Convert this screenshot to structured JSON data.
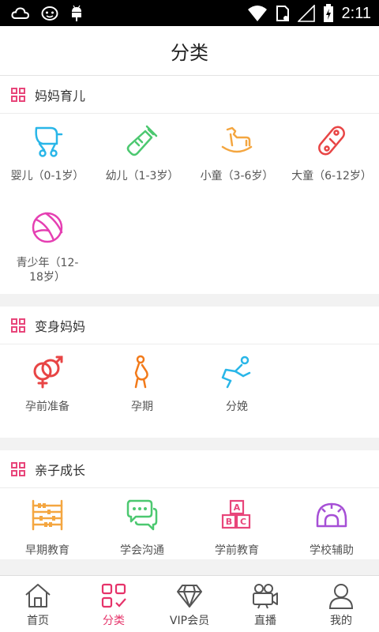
{
  "status_bar": {
    "time": "2:11"
  },
  "header": {
    "title": "分类"
  },
  "sections": [
    {
      "title": "妈妈育儿",
      "items": [
        {
          "label": "婴儿（0-1岁）",
          "icon": "stroller-icon",
          "color": "#29b6e8"
        },
        {
          "label": "幼儿（1-3岁）",
          "icon": "baby-bottle-icon",
          "color": "#4cc870"
        },
        {
          "label": "小童（3-6岁）",
          "icon": "rocking-horse-icon",
          "color": "#f4a640"
        },
        {
          "label": "大童（6-12岁）",
          "icon": "skateboard-icon",
          "color": "#e84545"
        },
        {
          "label": "青少年（12-18岁）",
          "icon": "ball-icon",
          "color": "#e53fb2"
        }
      ]
    },
    {
      "title": "变身妈妈",
      "items": [
        {
          "label": "孕前准备",
          "icon": "gender-icon",
          "color": "#e84545"
        },
        {
          "label": "孕期",
          "icon": "pregnant-icon",
          "color": "#f27a1a"
        },
        {
          "label": "分娩",
          "icon": "delivery-icon",
          "color": "#29b6e8"
        }
      ]
    },
    {
      "title": "亲子成长",
      "items": [
        {
          "label": "早期教育",
          "icon": "abacus-icon",
          "color": "#f4a640"
        },
        {
          "label": "学会沟通",
          "icon": "chat-icon",
          "color": "#4cc870"
        },
        {
          "label": "学前教育",
          "icon": "abc-blocks-icon",
          "color": "#e8457a"
        },
        {
          "label": "学校辅助",
          "icon": "protractor-icon",
          "color": "#a64fd6"
        }
      ]
    }
  ],
  "bottom_nav": [
    {
      "label": "首页",
      "icon": "home-icon",
      "active": false
    },
    {
      "label": "分类",
      "icon": "category-icon",
      "active": true
    },
    {
      "label": "VIP会员",
      "icon": "diamond-icon",
      "active": false
    },
    {
      "label": "直播",
      "icon": "video-camera-icon",
      "active": false
    },
    {
      "label": "我的",
      "icon": "profile-icon",
      "active": false
    }
  ],
  "colors": {
    "accent": "#e6336a",
    "section_icon": "#e8457a"
  }
}
